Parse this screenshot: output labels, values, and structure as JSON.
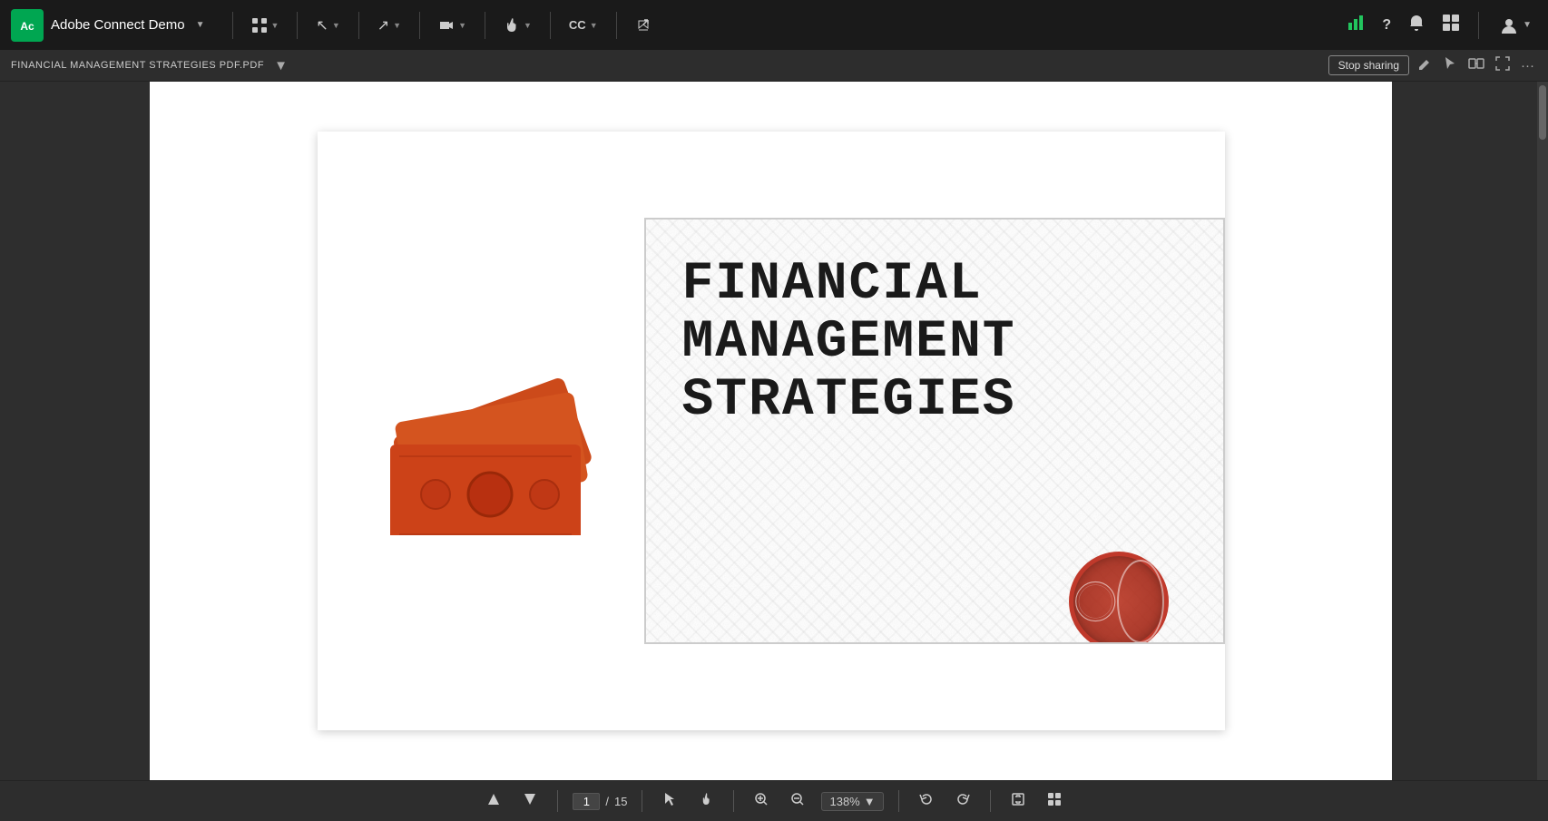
{
  "app": {
    "logo_text": "Ac",
    "name": "Adobe Connect Demo",
    "name_dropdown_arrow": "▼"
  },
  "top_nav": {
    "items": [
      {
        "id": "grid",
        "icon": "⊞",
        "has_arrow": true
      },
      {
        "id": "cursor",
        "icon": "↖",
        "has_arrow": true
      },
      {
        "id": "pointer",
        "icon": "✋",
        "has_arrow": true
      },
      {
        "id": "camera",
        "icon": "📷",
        "has_arrow": true
      },
      {
        "id": "hand",
        "icon": "✋",
        "has_arrow": true
      },
      {
        "id": "cc",
        "label": "CC",
        "has_arrow": true
      },
      {
        "id": "share",
        "icon": "⤷",
        "has_arrow": false
      }
    ]
  },
  "top_right": {
    "chart_icon": "📊",
    "help_icon": "?",
    "bell_icon": "🔔",
    "layout_icon": "⊡",
    "user_icon": "👤",
    "user_arrow": "▼"
  },
  "doc_bar": {
    "title": "FINANCIAL MANAGEMENT STRATEGIES PDF.PDF",
    "dropdown_arrow": "▼",
    "stop_sharing_label": "Stop sharing",
    "edit_icon": "✏",
    "pointer_icon": "↖",
    "sync_icon": "⇄",
    "fullscreen_icon": "⛶",
    "more_icon": "…"
  },
  "pdf": {
    "title_line1": "FINANCIAL",
    "title_line2": "MANAGEMENT",
    "title_line3": "STRATEGIES"
  },
  "bottom_toolbar": {
    "up_icon": "▲",
    "down_icon": "▼",
    "page_current": "1",
    "page_separator": "/",
    "page_total": "15",
    "cursor_icon": "↖",
    "hand_icon": "✋",
    "zoom_in": "+",
    "zoom_out": "−",
    "zoom_level": "138%",
    "zoom_arrow": "▼",
    "undo_icon": "↩",
    "redo_icon": "↪",
    "fit_page_icon": "⊡",
    "thumbnail_icon": "⊞"
  }
}
